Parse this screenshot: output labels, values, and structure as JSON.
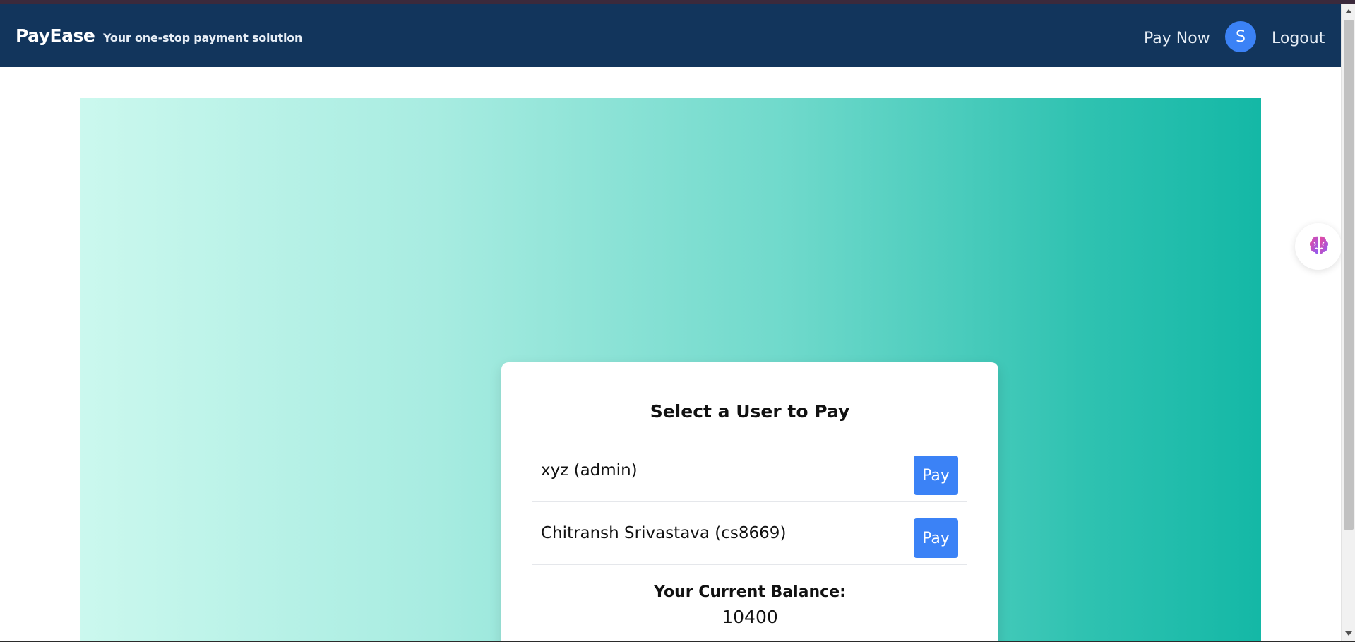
{
  "header": {
    "brand": "PayEase",
    "tagline": "Your one-stop payment solution",
    "pay_now_label": "Pay Now",
    "avatar_initial": "S",
    "logout_label": "Logout"
  },
  "card": {
    "title": "Select a User to Pay",
    "users": [
      {
        "name": "xyz (admin)",
        "action_label": "Pay"
      },
      {
        "name": "Chitransh Srivastava (cs8669)",
        "action_label": "Pay"
      }
    ],
    "balance_label": "Your Current Balance:",
    "balance_value": "10400"
  },
  "icons": {
    "assistant": "brain-icon"
  },
  "colors": {
    "navbar": "#12355c",
    "accent": "#3b82f6",
    "gradient_start": "#cbf8ee",
    "gradient_end": "#14b8a6"
  }
}
